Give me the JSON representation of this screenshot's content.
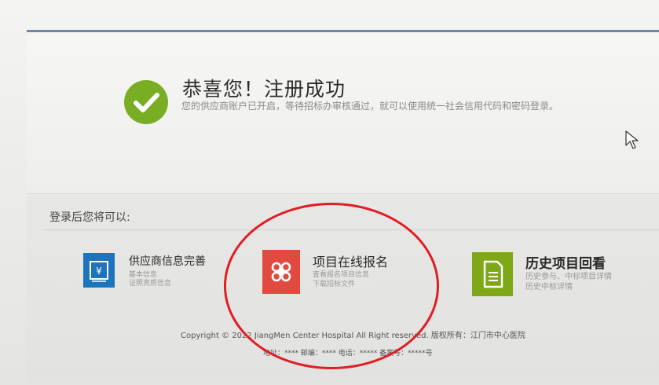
{
  "success": {
    "title": "恭喜您！注册成功",
    "description": "您的供应商账户已开启，等待招标办审核通过，就可以使用统一社会信用代码和密码登录。"
  },
  "features_label": "登录后您将可以:",
  "features": [
    {
      "name": "供应商信息完善",
      "sub1": "基本信息",
      "sub2": "证照资质信息",
      "icon": "invoice-icon",
      "color": "#1d74bb"
    },
    {
      "name": "项目在线报名",
      "sub1": "查看报名项目信息",
      "sub2": "下载招标文件",
      "icon": "command-icon",
      "color": "#e14b3f"
    },
    {
      "name": "历史项目回看",
      "sub1": "历史参与、中标项目详情",
      "sub2": "历史中标详情",
      "icon": "document-icon",
      "color": "#7fa818"
    }
  ],
  "footer": {
    "copyright": "Copyright © 2022 JiangMen Center Hospital All Right reserved. 版权所有：江门市中心医院",
    "address": "地址：**** 邮编：**** 电话：***** 备案号：*****号"
  },
  "colors": {
    "check": "#79ad23",
    "annotation": "#e11d24",
    "top_bar": "#6d86a6"
  }
}
